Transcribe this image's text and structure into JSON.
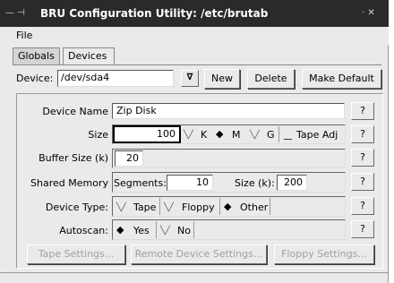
{
  "window": {
    "title": "BRU Configuration Utility: /etc/brutab",
    "left_controls": "— ⊣",
    "right_controls": "·  ✕"
  },
  "menu": {
    "file": "File"
  },
  "tabs": [
    {
      "label": "Globals",
      "active": false
    },
    {
      "label": "Devices",
      "active": true
    }
  ],
  "device": {
    "label": "Device:",
    "value": "/dev/sda4",
    "dropdown_glyph": "∇",
    "buttons": {
      "new": "New",
      "delete": "Delete",
      "make_default": "Make Default"
    }
  },
  "form": {
    "help_label": "?",
    "device_name": {
      "label": "Device Name",
      "value": "Zip Disk"
    },
    "size": {
      "label": "Size",
      "value": "100",
      "units": [
        {
          "label": "K",
          "selected": false
        },
        {
          "label": "M",
          "selected": true
        },
        {
          "label": "G",
          "selected": false
        }
      ],
      "tape_adj": {
        "label": "Tape Adj",
        "checked": false
      }
    },
    "buffer_size": {
      "label": "Buffer Size (k)",
      "value": "20"
    },
    "shared_memory": {
      "label": "Shared Memory",
      "segments_label": "Segments:",
      "segments_value": "10",
      "size_label": "Size (k):",
      "size_value": "200"
    },
    "device_type": {
      "label": "Device Type:",
      "options": [
        {
          "label": "Tape",
          "selected": false
        },
        {
          "label": "Floppy",
          "selected": false
        },
        {
          "label": "Other",
          "selected": true
        }
      ]
    },
    "autoscan": {
      "label": "Autoscan:",
      "options": [
        {
          "label": "Yes",
          "selected": true
        },
        {
          "label": "No",
          "selected": false
        }
      ]
    }
  },
  "settings_buttons": {
    "tape": "Tape Settings...",
    "remote": "Remote Device Settings...",
    "floppy": "Floppy Settings..."
  },
  "glyphs": {
    "radio_on": "◆",
    "radio_off": "╲╱"
  }
}
